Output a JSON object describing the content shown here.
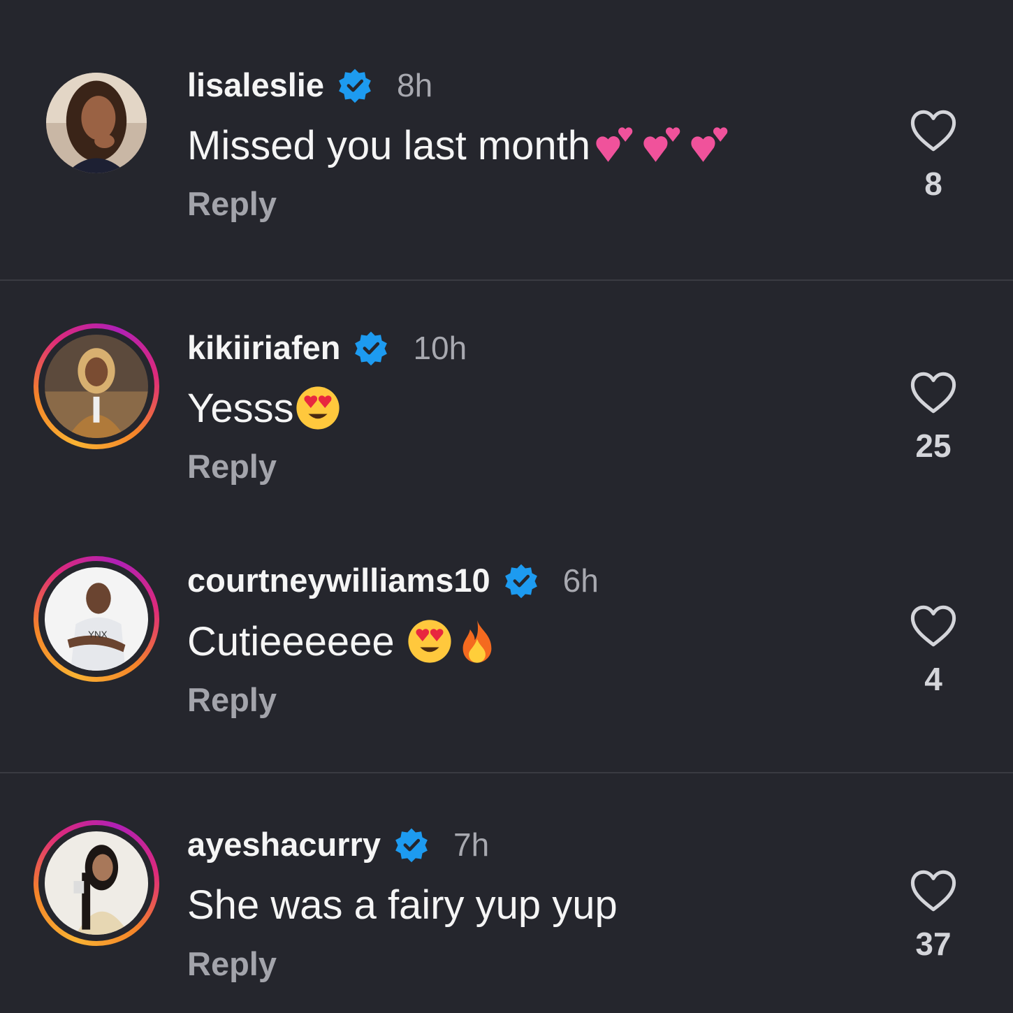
{
  "comments": [
    {
      "username": "lisaleslie",
      "time": "8h",
      "text": "Missed you last month",
      "emojis": [
        "two-hearts",
        "two-hearts",
        "two-hearts"
      ],
      "reply": "Reply",
      "likes": "8",
      "has_story_ring": false
    },
    {
      "username": "kikiiriafen",
      "time": "10h",
      "text": "Yesss",
      "emojis": [
        "heart-eyes"
      ],
      "reply": "Reply",
      "likes": "25",
      "has_story_ring": true
    },
    {
      "username": "courtneywilliams10",
      "time": "6h",
      "text": "Cutieeeeee ",
      "emojis": [
        "heart-eyes",
        "fire"
      ],
      "reply": "Reply",
      "likes": "4",
      "has_story_ring": true
    },
    {
      "username": "ayeshacurry",
      "time": "7h",
      "text": "She was a fairy yup yup",
      "emojis": [],
      "reply": "Reply",
      "likes": "37",
      "has_story_ring": true
    }
  ],
  "colors": {
    "background": "#25262d",
    "verified_badge": "#1d9bf0",
    "secondary_text": "#a8a9b0"
  },
  "icons": {
    "verified": "verified-badge-icon",
    "like": "heart-outline-icon"
  }
}
